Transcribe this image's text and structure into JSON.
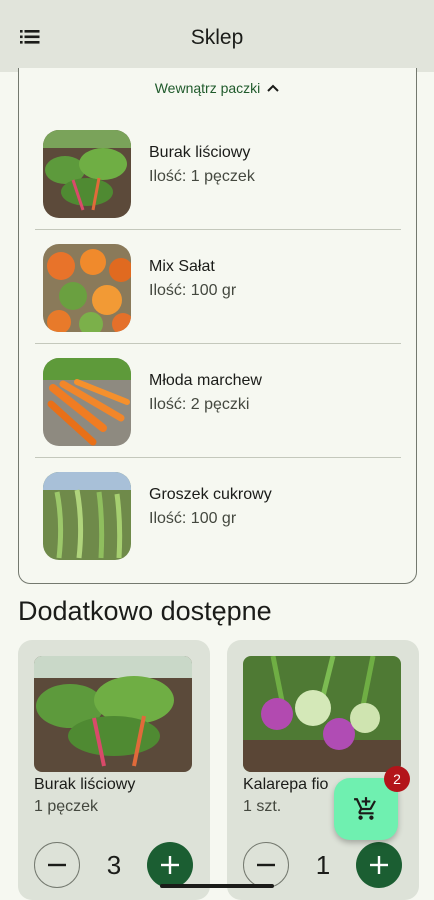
{
  "appbar": {
    "title": "Sklep",
    "menu_icon": "list-menu-icon"
  },
  "package": {
    "toggle_label": "Wewnątrz paczki",
    "items": [
      {
        "name": "Burak liściowy",
        "quantity": "Ilość: 1 pęczek"
      },
      {
        "name": "Mix Sałat",
        "quantity": "Ilość: 100 gr"
      },
      {
        "name": "Młoda marchew",
        "quantity": "Ilość: 2 pęczki"
      },
      {
        "name": "Groszek cukrowy",
        "quantity": "Ilość: 100 gr"
      }
    ]
  },
  "extras": {
    "title": "Dodatkowo dostępne",
    "items": [
      {
        "name": "Burak liściowy",
        "unit": "1 pęczek",
        "count": "3"
      },
      {
        "name": "Kalarepa fio",
        "unit": "1 szt.",
        "count": "1"
      }
    ]
  },
  "cart": {
    "badge": "2"
  },
  "colors": {
    "accent": "#1b5e32",
    "fab": "#6ff0b0",
    "badge": "#b3141a"
  }
}
